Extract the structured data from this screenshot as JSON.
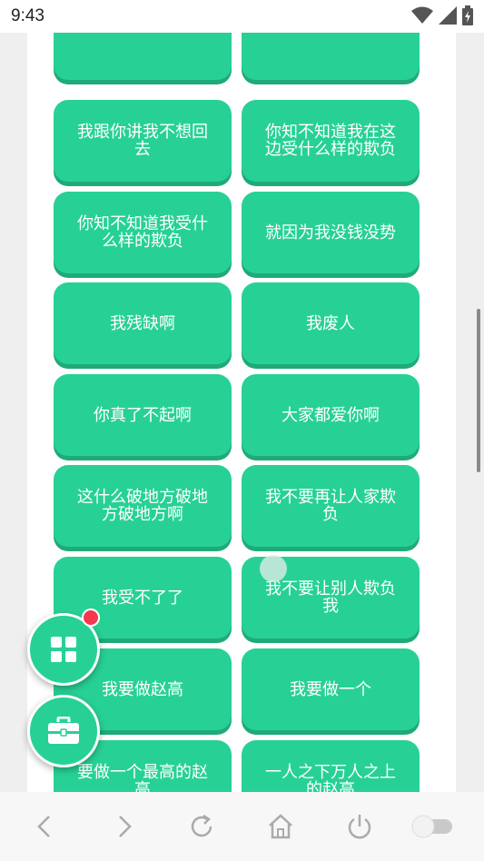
{
  "status": {
    "time": "9:43"
  },
  "buttons": [
    {
      "label": ""
    },
    {
      "label": ""
    },
    {
      "label": "我跟你讲我不想回去"
    },
    {
      "label": "你知不知道我在这边受什么样的欺负"
    },
    {
      "label": "你知不知道我受什么样的欺负"
    },
    {
      "label": "就因为我没钱没势"
    },
    {
      "label": "我残缺啊"
    },
    {
      "label": "我废人"
    },
    {
      "label": "你真了不起啊"
    },
    {
      "label": "大家都爱你啊"
    },
    {
      "label": "这什么破地方破地方破地方啊"
    },
    {
      "label": "我不要再让人家欺负"
    },
    {
      "label": "我受不了了"
    },
    {
      "label": "我不要让别人欺负我"
    },
    {
      "label": "我要做赵高"
    },
    {
      "label": "我要做一个"
    },
    {
      "label": "要做一个最高的赵高"
    },
    {
      "label": "一人之下万人之上的赵高"
    }
  ],
  "colors": {
    "accent": "#27d195",
    "accent_shadow": "#1faa78",
    "badge": "#f4384d"
  },
  "icons": [
    "grid-icon",
    "toolbox-icon",
    "back-icon",
    "forward-icon",
    "refresh-icon",
    "home-icon",
    "power-icon",
    "toggle-icon",
    "wifi-icon",
    "signal-icon",
    "battery-icon"
  ]
}
